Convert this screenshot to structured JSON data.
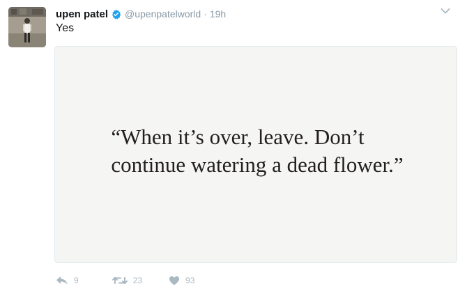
{
  "tweet": {
    "author": {
      "display_name": "upen patel",
      "handle": "@upenpatelworld",
      "verified": true,
      "avatar_icon": "profile-photo"
    },
    "separator": "·",
    "timestamp": "19h",
    "text": "Yes",
    "media": {
      "quote_lines": [
        "“When it’s over, leave. Don’t",
        "continue watering a dead flower.”"
      ]
    },
    "actions": {
      "reply": {
        "icon": "reply-icon",
        "count": "9"
      },
      "retweet": {
        "icon": "retweet-icon",
        "count": "23"
      },
      "like": {
        "icon": "heart-icon",
        "count": "93"
      }
    },
    "menu_icon": "chevron-down-icon"
  },
  "colors": {
    "verified_blue": "#1da1f2",
    "muted_text": "#8899a6",
    "action_icon": "#aab8c2",
    "media_background": "#f5f5f3",
    "quote_text": "#231f1c"
  }
}
